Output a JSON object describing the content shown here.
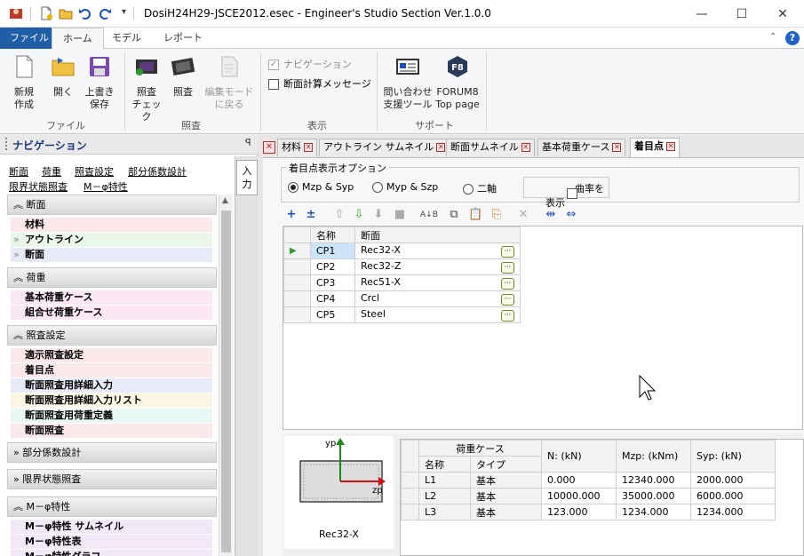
{
  "window": {
    "title": "DosiH24H29-JSCE2012.esec - Engineer's Studio Section Ver.1.0.0",
    "controls": [
      "—",
      "☐",
      "✕"
    ]
  },
  "menu": {
    "file": "ファイル",
    "tabs": [
      "ホーム",
      "モデル",
      "レポート"
    ]
  },
  "ribbon": {
    "buttons": {
      "new": [
        "新規",
        "作成"
      ],
      "open": "開く",
      "save": [
        "上書き",
        "保存"
      ],
      "check_verify": [
        "照査",
        "チェック"
      ],
      "verify": "照査",
      "edit_back": [
        "編集モード",
        "に戻る"
      ],
      "inquiry": [
        "問い合わせ",
        "支援ツール"
      ],
      "forum8": [
        "FORUM8",
        "Top page"
      ]
    },
    "groups": {
      "file": "ファイル",
      "verify": "照査",
      "display": "表示",
      "support": "サポート"
    },
    "checks": {
      "navigation": "ナビゲーション",
      "message": "断面計算メッセージ"
    }
  },
  "nav": {
    "title": "ナビゲーション",
    "pin": "ᵖ",
    "links_row1": [
      "断面",
      "荷重",
      "照査設定",
      "部分係数設計"
    ],
    "links_row2": [
      "限界状態照査",
      "M－φ特性"
    ],
    "side_tab": [
      "入",
      "力"
    ],
    "sections": {
      "section": "断面",
      "load": "荷重",
      "verify": "照査設定",
      "partial": "部分係数設計",
      "limit": "限界状態照査",
      "mphi": "M－φ特性"
    },
    "section_items": [
      "材料",
      "アウトライン",
      "断面"
    ],
    "load_items": [
      "基本荷重ケース",
      "組合せ荷重ケース"
    ],
    "verify_items": [
      "適示照査設定",
      "着目点",
      "断面照査用詳細入力",
      "断面照査用詳細入力リスト",
      "断面照査用荷重定義",
      "断面照査"
    ],
    "mphi_items": [
      "M－φ特性 サムネイル",
      "M－φ特性表",
      "M－φ特性グラフ"
    ]
  },
  "doc_tabs": [
    {
      "label": "材料"
    },
    {
      "label": "アウトライン サムネイル"
    },
    {
      "label": "断面サムネイル"
    },
    {
      "label": "基本荷重ケース"
    },
    {
      "label": "着目点"
    }
  ],
  "options": {
    "title": "着目点表示オプション",
    "radios": [
      "Mzp & Syp",
      "Myp & Szp",
      "二軸"
    ],
    "curvature": "曲率を表示"
  },
  "points_table": {
    "headers": [
      "名称",
      "断面"
    ],
    "rows": [
      {
        "name": "CP1",
        "section": "Rec32-X"
      },
      {
        "name": "CP2",
        "section": "Rec32-Z"
      },
      {
        "name": "CP3",
        "section": "Rec51-X"
      },
      {
        "name": "CP4",
        "section": "Crcl"
      },
      {
        "name": "CP5",
        "section": "Steel"
      }
    ],
    "edit_glyph": "···"
  },
  "preview": {
    "y_label": "yp",
    "z_label": "zp",
    "caption": "Rec32-X"
  },
  "load_table": {
    "group_header": "荷重ケース",
    "headers": [
      "名称",
      "タイプ",
      "N: (kN)",
      "Mzp: (kNm)",
      "Syp: (kN)"
    ],
    "rows": [
      {
        "name": "L1",
        "type": "基本",
        "n": "0.000",
        "mzp": "12340.000",
        "syp": "2000.000"
      },
      {
        "name": "L2",
        "type": "基本",
        "n": "10000.000",
        "mzp": "35000.000",
        "syp": "6000.000"
      },
      {
        "name": "L3",
        "type": "基本",
        "n": "123.000",
        "mzp": "1234.000",
        "syp": "1234.000"
      }
    ]
  },
  "colors": {
    "file_tab": "#1f5fa8",
    "accent_blue": "#1a50c0",
    "selected_row": "#cce4f7",
    "axis_y": "#1a8a1a",
    "axis_z": "#d01010"
  }
}
